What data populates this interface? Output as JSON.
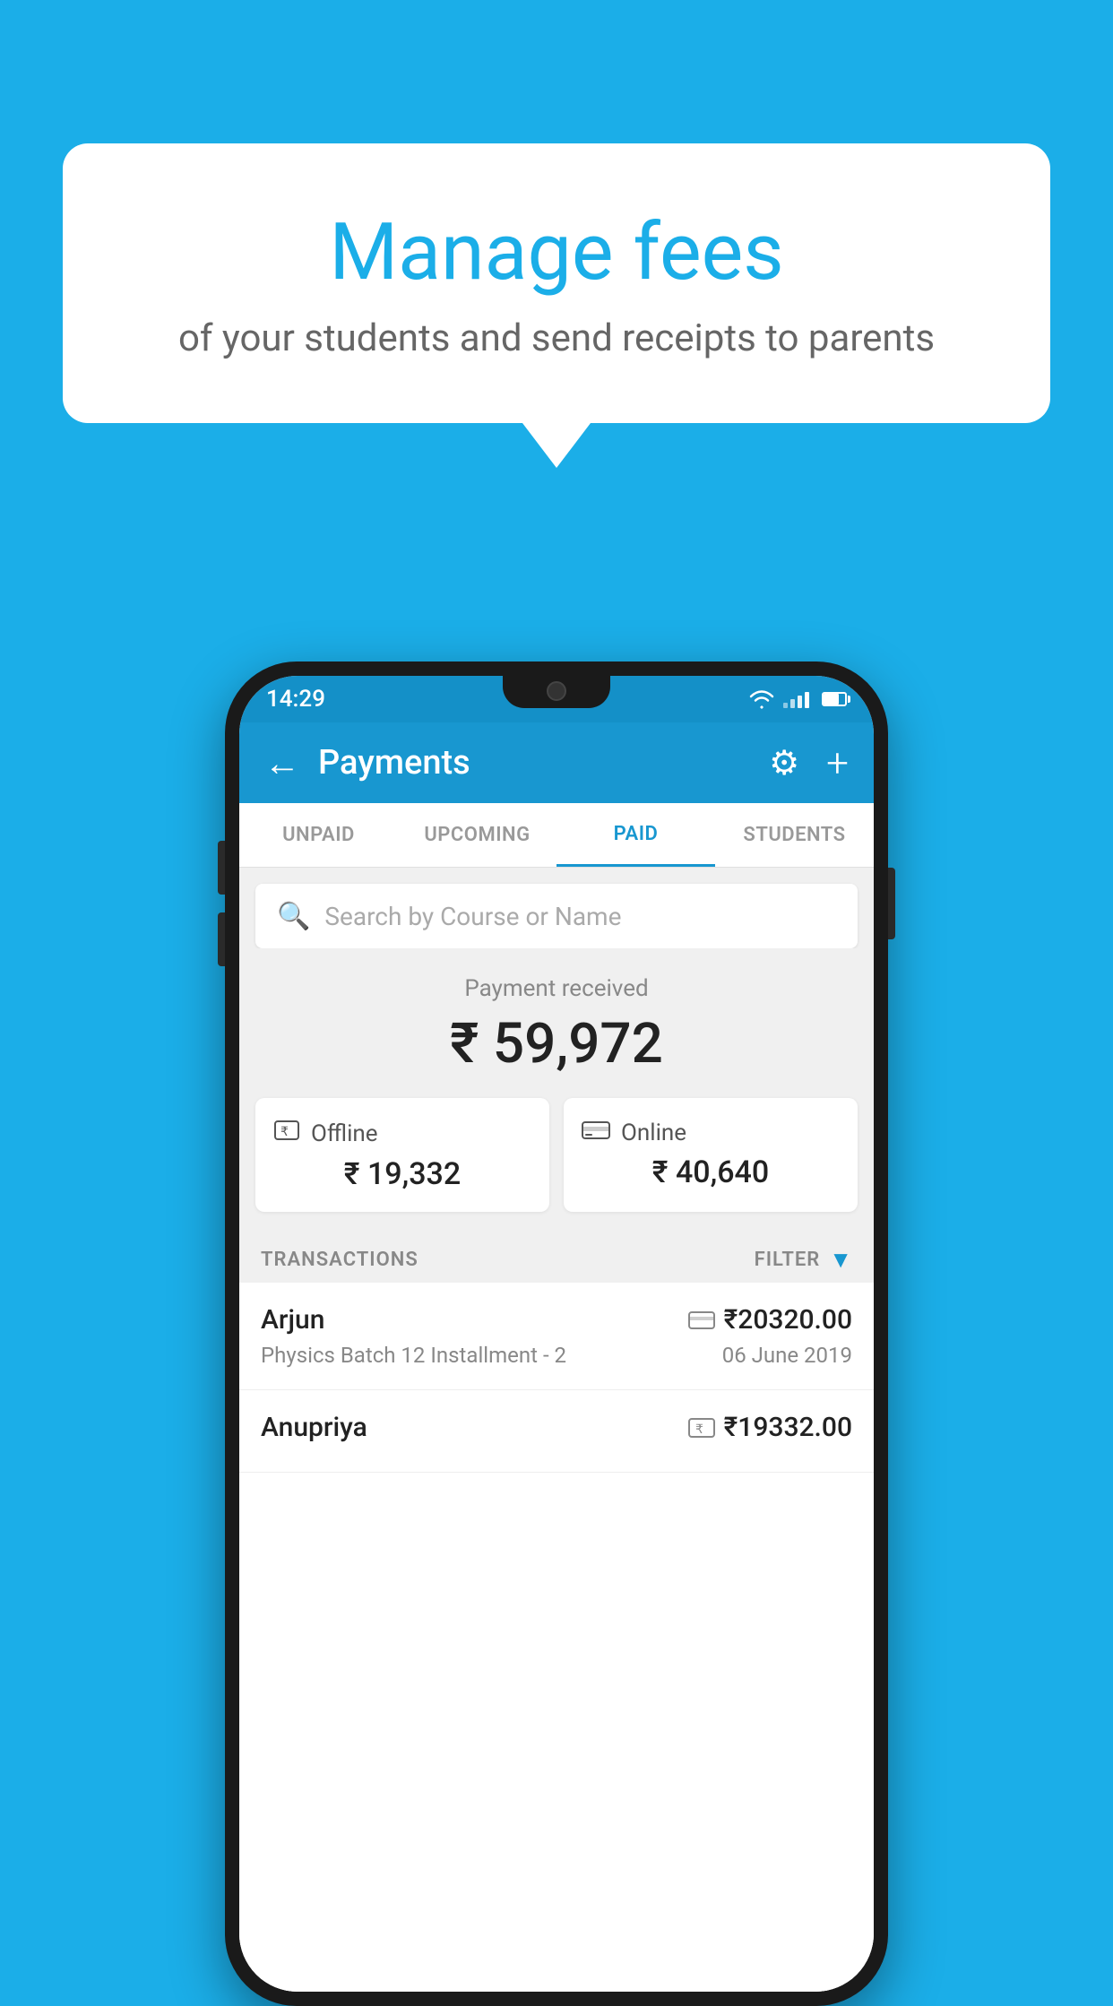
{
  "background_color": "#1BAEE8",
  "speech_bubble": {
    "title": "Manage fees",
    "subtitle": "of your students and send receipts to parents"
  },
  "status_bar": {
    "time": "14:29"
  },
  "app_bar": {
    "title": "Payments",
    "back_label": "←",
    "settings_label": "⚙",
    "add_label": "+"
  },
  "tabs": [
    {
      "label": "UNPAID",
      "active": false
    },
    {
      "label": "UPCOMING",
      "active": false
    },
    {
      "label": "PAID",
      "active": true
    },
    {
      "label": "STUDENTS",
      "active": false
    }
  ],
  "search": {
    "placeholder": "Search by Course or Name"
  },
  "payment_summary": {
    "label": "Payment received",
    "amount": "₹ 59,972",
    "offline": {
      "label": "Offline",
      "amount": "₹ 19,332"
    },
    "online": {
      "label": "Online",
      "amount": "₹ 40,640"
    }
  },
  "transactions": {
    "header_label": "TRANSACTIONS",
    "filter_label": "FILTER",
    "items": [
      {
        "name": "Arjun",
        "course": "Physics Batch 12 Installment - 2",
        "amount": "₹20320.00",
        "payment_type": "card",
        "date": "06 June 2019"
      },
      {
        "name": "Anupriya",
        "course": "",
        "amount": "₹19332.00",
        "payment_type": "offline",
        "date": ""
      }
    ]
  }
}
